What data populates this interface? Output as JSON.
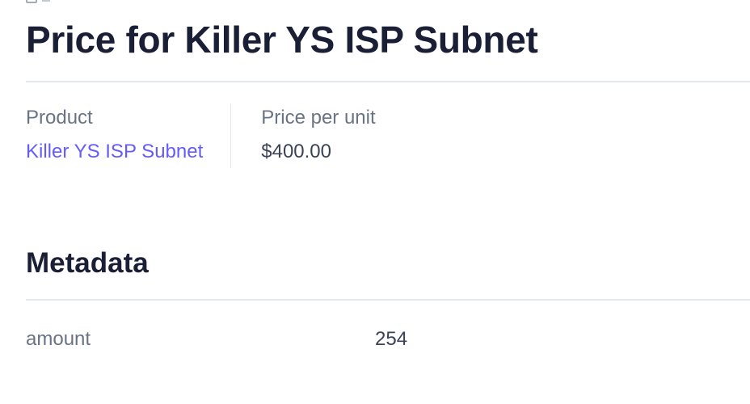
{
  "header": {
    "title": "Price for Killer YS ISP Subnet"
  },
  "summary": {
    "product_label": "Product",
    "product_value": "Killer YS ISP Subnet",
    "price_label": "Price per unit",
    "price_value": "$400.00"
  },
  "metadata": {
    "title": "Metadata",
    "rows": [
      {
        "key": "amount",
        "value": "254"
      }
    ]
  },
  "colors": {
    "link": "#635bff",
    "heading": "#1a1f36",
    "muted": "#697386",
    "divider": "#e3e8ee"
  }
}
